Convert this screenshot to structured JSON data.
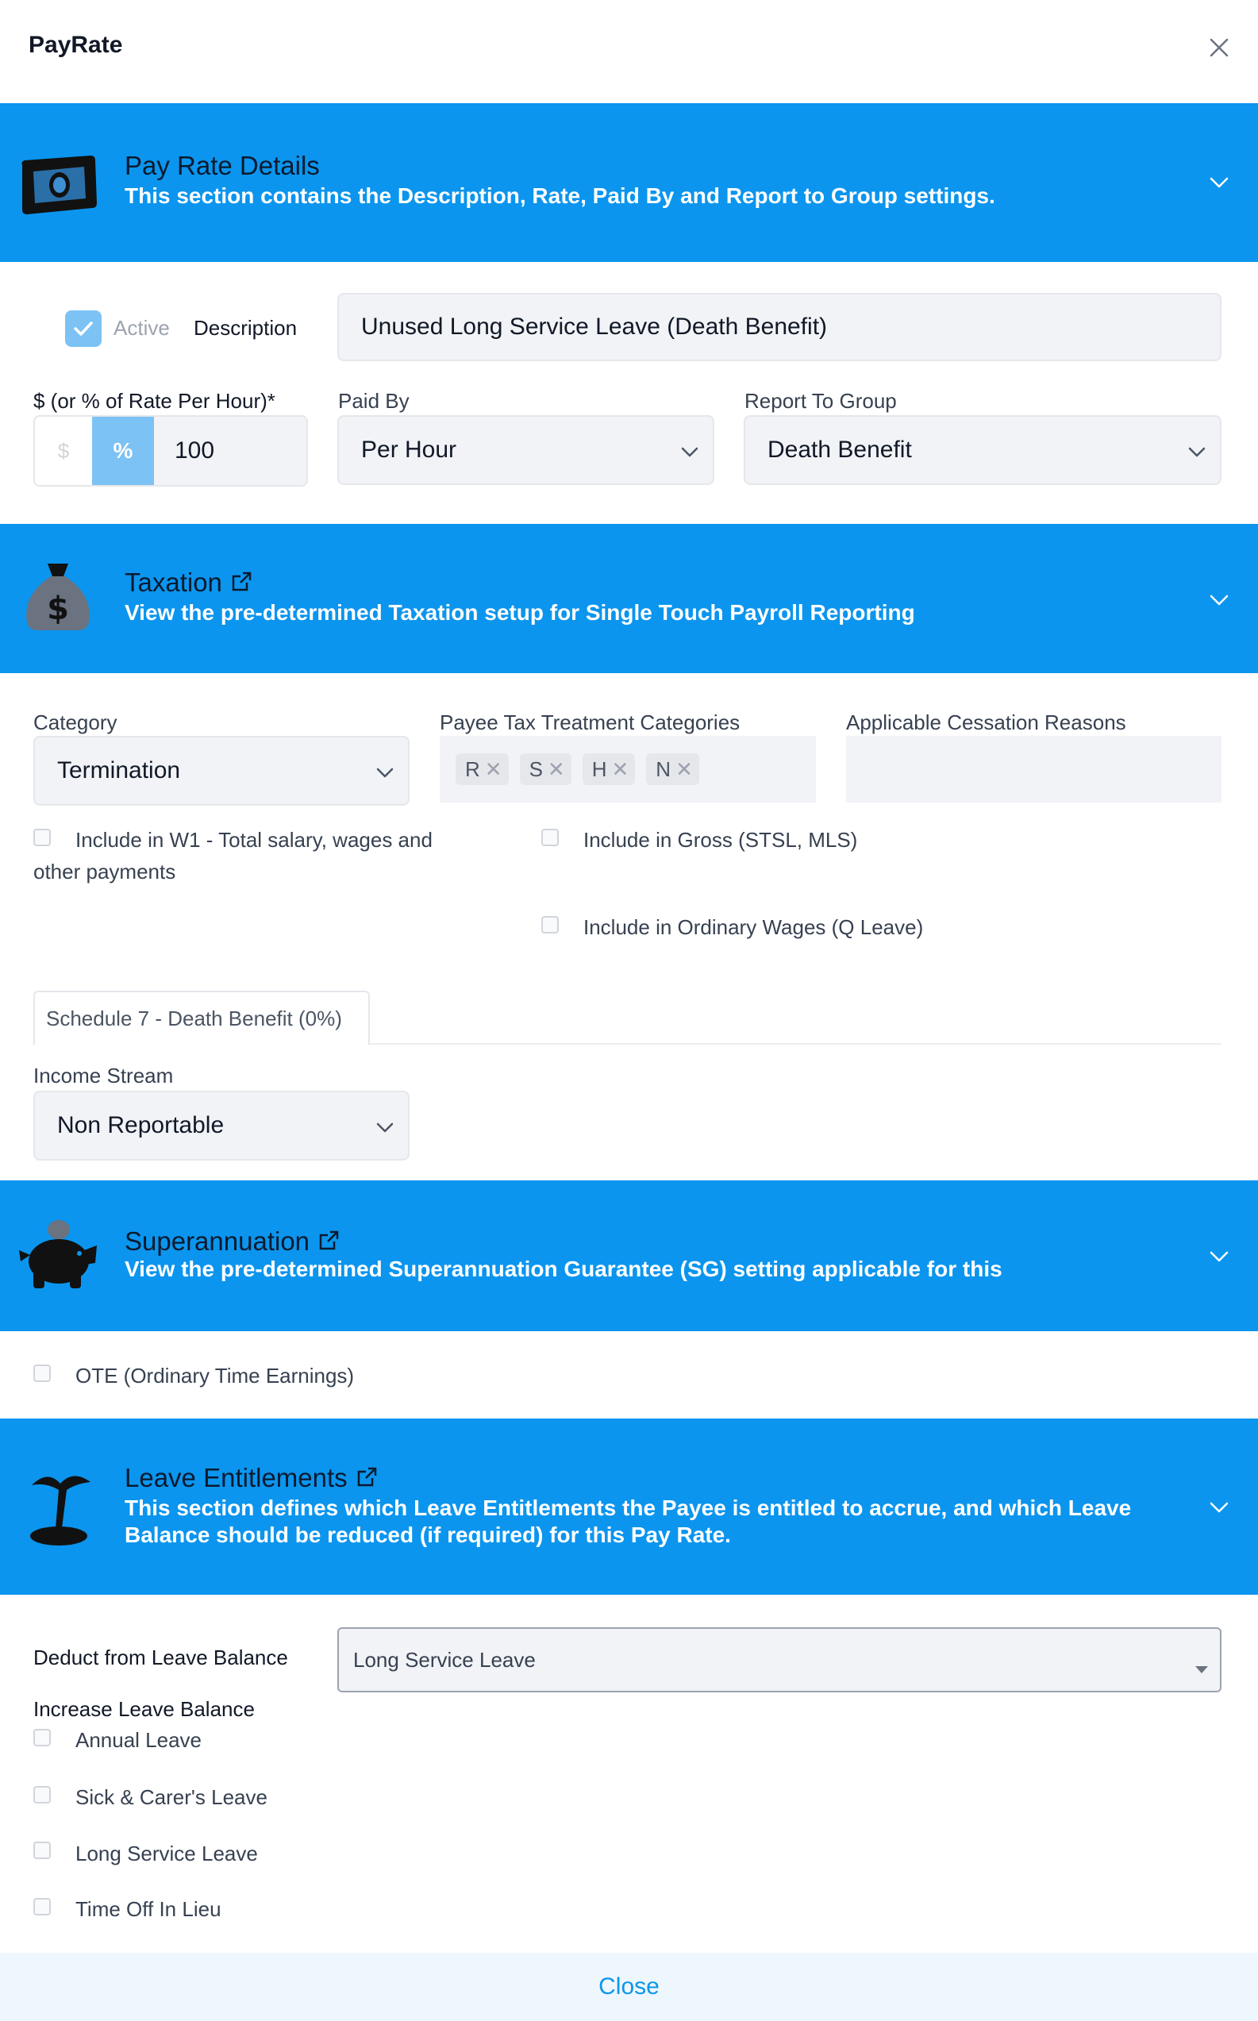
{
  "modal": {
    "title": "PayRate",
    "close_label": "Close"
  },
  "colors": {
    "accent": "#0b95ee",
    "banner_title": "#0b1a2e",
    "field_bg": "#f1f3f6"
  },
  "pay_rate_details": {
    "title": "Pay Rate Details",
    "description": "This section contains the Description, Rate, Paid By and Report to Group settings.",
    "icon": "money-bill-icon",
    "active_label": "Active",
    "active_checked": true,
    "description_label": "Description",
    "description_value": "Unused Long Service Leave (Death Benefit)",
    "rate_label": "$ (or % of Rate Per Hour)*",
    "dollar_symbol": "$",
    "percent_symbol": "%",
    "rate_value": "100",
    "paid_by_label": "Paid By",
    "paid_by_value": "Per Hour",
    "report_group_label": "Report To Group",
    "report_group_value": "Death Benefit"
  },
  "taxation": {
    "title": "Taxation",
    "description": "View the pre-determined Taxation setup for Single Touch Payroll Reporting",
    "icon": "money-bag-icon",
    "category_label": "Category",
    "category_value": "Termination",
    "payee_tax_label": "Payee Tax Treatment Categories",
    "payee_tax_chips": [
      "R",
      "S",
      "H",
      "N"
    ],
    "cessation_label": "Applicable Cessation Reasons",
    "w1_label_line1": "Include in W1 - Total salary, wages and",
    "w1_label_line2": "other payments",
    "gross_label": "Include in Gross (STSL, MLS)",
    "ordinary_wages_label": "Include in Ordinary Wages (Q Leave)",
    "schedule_tab": "Schedule 7 - Death Benefit (0%)",
    "income_stream_label": "Income Stream",
    "income_stream_value": "Non Reportable"
  },
  "superannuation": {
    "title": "Superannuation",
    "description": "View the pre-determined Superannuation Guarantee (SG) setting applicable for this",
    "icon": "piggy-bank-icon",
    "ote_label": "OTE (Ordinary Time Earnings)"
  },
  "leave": {
    "title": "Leave Entitlements",
    "description_line1": "This section defines which Leave Entitlements the Payee is entitled to accrue, and which Leave",
    "description_line2": "Balance should be reduced (if required) for this Pay Rate.",
    "icon": "palm-tree-icon",
    "deduct_label": "Deduct from Leave Balance",
    "deduct_value": "Long Service Leave",
    "increase_label": "Increase Leave Balance",
    "items": [
      "Annual Leave",
      "Sick & Carer's Leave",
      "Long Service Leave",
      "Time Off In Lieu"
    ]
  }
}
